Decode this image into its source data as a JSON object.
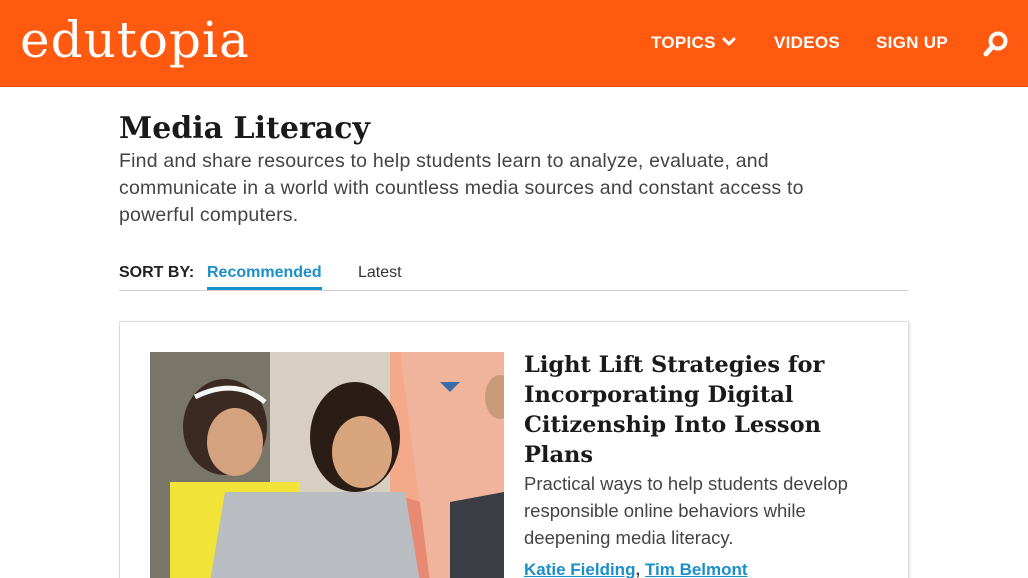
{
  "header": {
    "logo": "edutopia",
    "nav": {
      "topics": "TOPICS",
      "videos": "VIDEOS",
      "signup": "SIGN UP"
    },
    "icons": {
      "topics_dropdown": "chevron-down-icon",
      "search": "search-icon"
    },
    "colors": {
      "brand": "#ff5a0f",
      "link": "#1a8fc9"
    }
  },
  "page": {
    "title": "Media Literacy",
    "description": "Find and share resources to help students learn to analyze, evaluate, and communicate in a world with countless media sources and constant access to powerful computers."
  },
  "sort": {
    "label": "SORT BY:",
    "options": [
      "Recommended",
      "Latest"
    ],
    "selected": "Recommended"
  },
  "articles": [
    {
      "title": "Light Lift Strategies for Incorporating Digital Citizenship Into Lesson Plans",
      "summary": "Practical ways to help students develop responsible online behaviors while deepening media literacy.",
      "authors": [
        "Katie Fielding",
        "Tim Belmont"
      ],
      "author_separator": ","
    }
  ]
}
